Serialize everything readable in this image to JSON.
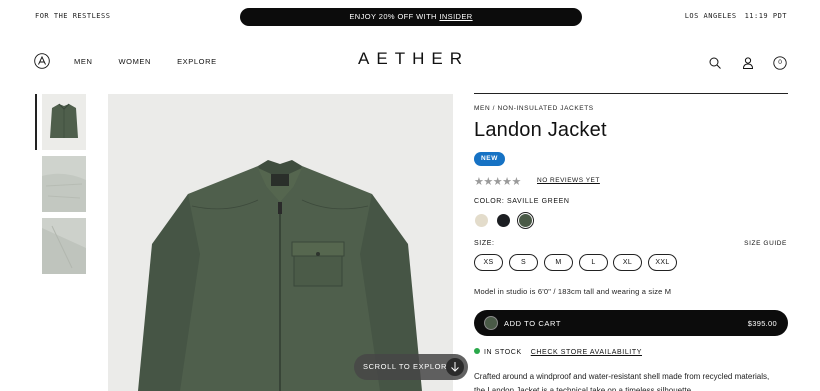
{
  "topbar": {
    "tagline": "FOR THE RESTLESS",
    "promo_text": "ENJOY 20% OFF WITH ",
    "promo_link": "INSIDER",
    "location": "LOS ANGELES",
    "time": "11:19 PDT"
  },
  "nav": {
    "links": [
      "MEN",
      "WOMEN",
      "EXPLORE"
    ],
    "brand": "AETHER",
    "cart_count": "0",
    "icons": [
      "search-icon",
      "account-icon",
      "cart-icon"
    ]
  },
  "gallery": {
    "thumb_count": 3,
    "scroll_label": "SCROLL TO EXPLORE"
  },
  "product": {
    "breadcrumb": "MEN / NON-INSULATED JACKETS",
    "title": "Landon Jacket",
    "badge": "NEW",
    "rating_stars": "★★★★★",
    "reviews_label": "NO REVIEWS YET",
    "color_label": "COLOR: SAVILLE GREEN",
    "swatches": [
      {
        "name": "cream",
        "color": "#e3dccb"
      },
      {
        "name": "black",
        "color": "#1c1e22"
      },
      {
        "name": "saville-green",
        "color": "#4a5a47",
        "selected": true
      }
    ],
    "size_label": "SIZE:",
    "size_guide": "SIZE GUIDE",
    "sizes": [
      "XS",
      "S",
      "M",
      "L",
      "XL",
      "XXL"
    ],
    "model_note": "Model in studio is 6'0\" / 183cm tall and wearing a size M",
    "add_to_cart": "ADD TO CART",
    "price": "$395.00",
    "stock": "IN STOCK",
    "check_store": "CHECK STORE AVAILABILITY",
    "description": "Crafted around a windproof and water-resistant shell made from recycled materials, the Landon Jacket is a technical take on a timeless silhouette"
  },
  "colors": {
    "accent_blue": "#1672c4",
    "in_stock_green": "#2aa84a",
    "jacket_green": "#4f5f4c"
  }
}
